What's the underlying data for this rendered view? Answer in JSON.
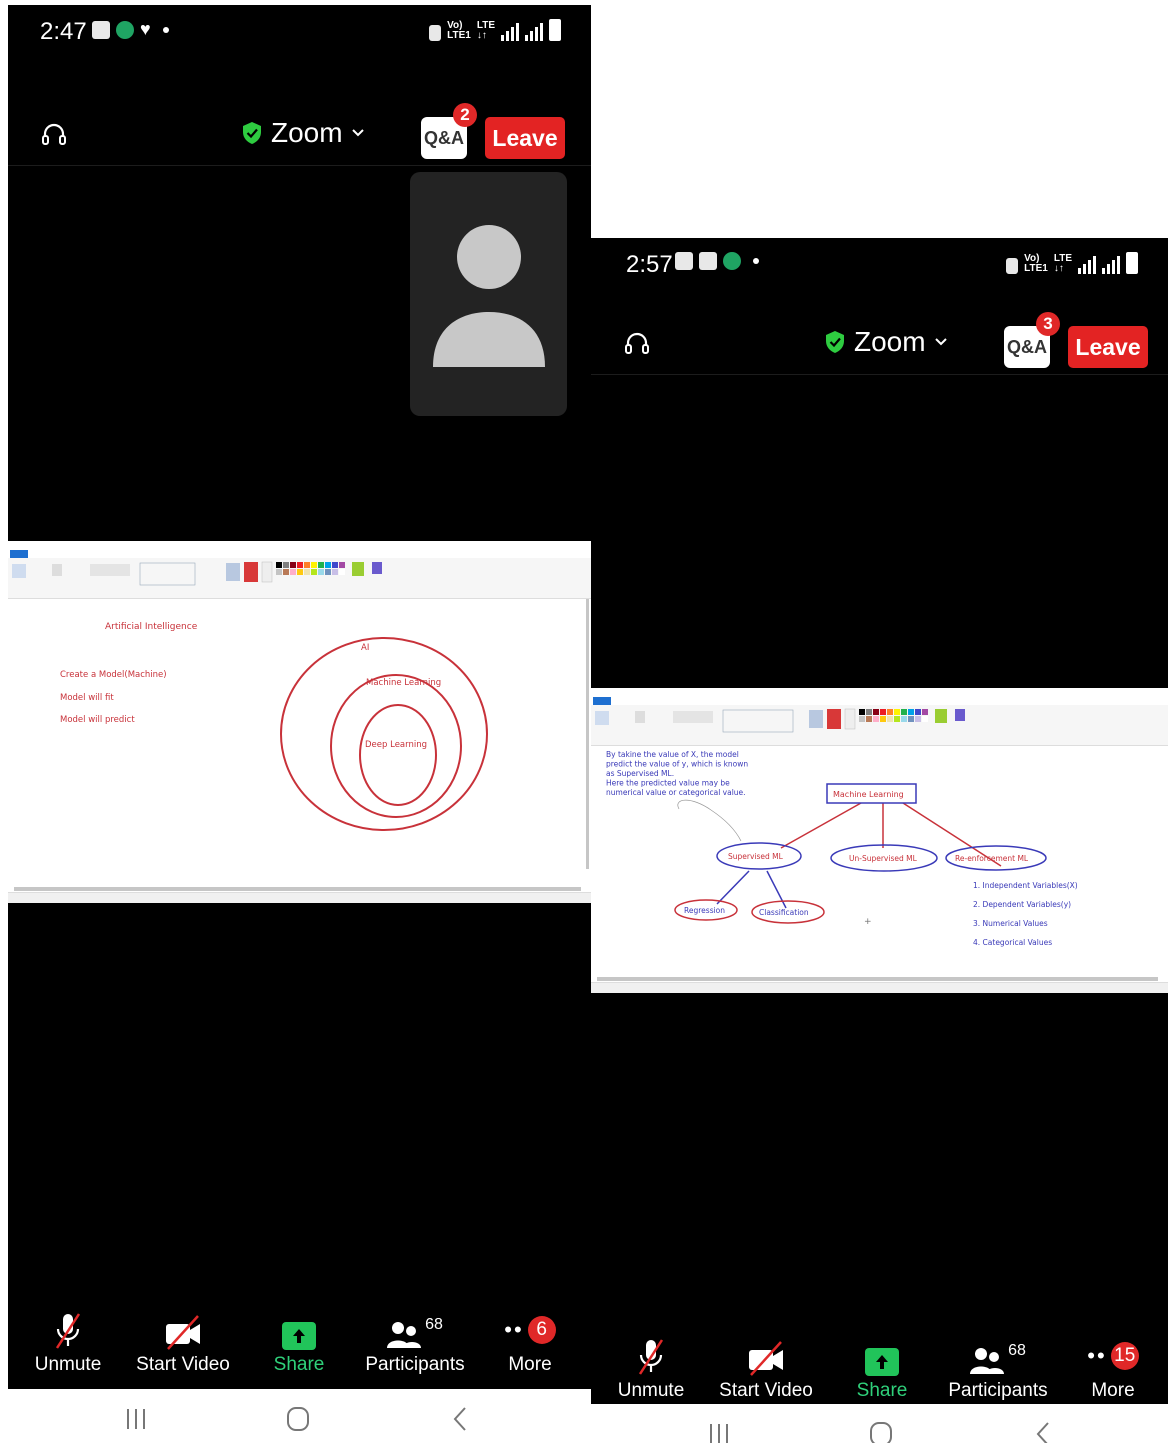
{
  "screens": [
    {
      "status": {
        "time": "2:47",
        "lte_top": "Vo)",
        "lte_bottom": "LTE1",
        "lte_label": "LTE"
      },
      "header": {
        "title": "Zoom",
        "qa_label": "Q&A",
        "qa_badge": "2",
        "leave_label": "Leave"
      },
      "shared_screen": {
        "heading": "Artificial Intelligence",
        "left_lines": [
          "Create a Model(Machine)",
          "Model will fit",
          "Model will predict"
        ],
        "circle_labels": [
          "AI",
          "Machine Learning",
          "Deep Learning"
        ]
      },
      "toolbar": {
        "unmute": "Unmute",
        "start_video": "Start Video",
        "share": "Share",
        "participants": "Participants",
        "participants_count": "68",
        "more": "More",
        "more_badge": "6"
      }
    },
    {
      "status": {
        "time": "2:57",
        "lte_top": "Vo)",
        "lte_bottom": "LTE1",
        "lte_label": "LTE"
      },
      "header": {
        "title": "Zoom",
        "qa_label": "Q&A",
        "qa_badge": "3",
        "leave_label": "Leave"
      },
      "shared_screen": {
        "paragraph": [
          "By takine the value of X, the model",
          "predict the value of y, which is known",
          "as Supervised ML.",
          "Here the predicted value may be",
          "numerical value or categorical value."
        ],
        "root": "Machine Learning",
        "branches": [
          "Supervised ML",
          "Un-Supervised ML",
          "Re-enforcement ML"
        ],
        "leaves": [
          "Regression",
          "Classification"
        ],
        "list": [
          "1. Independent Variables(X)",
          "2. Dependent Variables(y)",
          "3. Numerical Values",
          "4. Categorical Values"
        ]
      },
      "toolbar": {
        "unmute": "Unmute",
        "start_video": "Start Video",
        "share": "Share",
        "participants": "Participants",
        "participants_count": "68",
        "more": "More",
        "more_badge": "15"
      }
    }
  ],
  "colors": {
    "leave": "#e32323",
    "badge": "#e02828",
    "share_green": "#21c45a",
    "shield": "#2ecc40",
    "ink_red": "#c8323a",
    "ink_blue": "#3a3ab8"
  }
}
